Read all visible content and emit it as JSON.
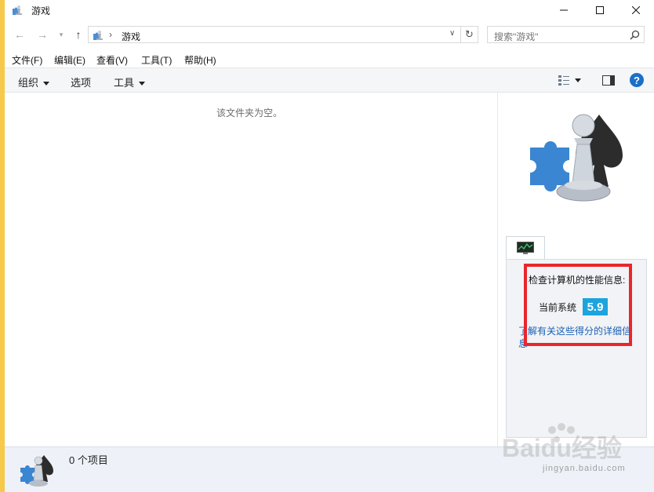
{
  "window": {
    "title": "游戏"
  },
  "address": {
    "path_item": "游戏"
  },
  "search": {
    "placeholder": "搜索\"游戏\""
  },
  "menu": [
    "文件(F)",
    "编辑(E)",
    "查看(V)",
    "工具(T)",
    "帮助(H)"
  ],
  "toolbar": {
    "organize": "组织",
    "options": "选项",
    "tools": "工具"
  },
  "content": {
    "empty_message": "该文件夹为空。"
  },
  "preview": {
    "perf_title": "检查计算机的性能信息:",
    "current_label": "当前系统",
    "score": "5.9",
    "link_text": "了解有关这些得分的详细信息"
  },
  "status": {
    "items_count": "0 个项目"
  },
  "watermark": {
    "brand": "Baidu经验",
    "url": "jingyan.baidu.com"
  },
  "colors": {
    "accent_blue": "#1ca4de",
    "highlight_red": "#e8262c",
    "link_blue": "#1a5fb4"
  }
}
